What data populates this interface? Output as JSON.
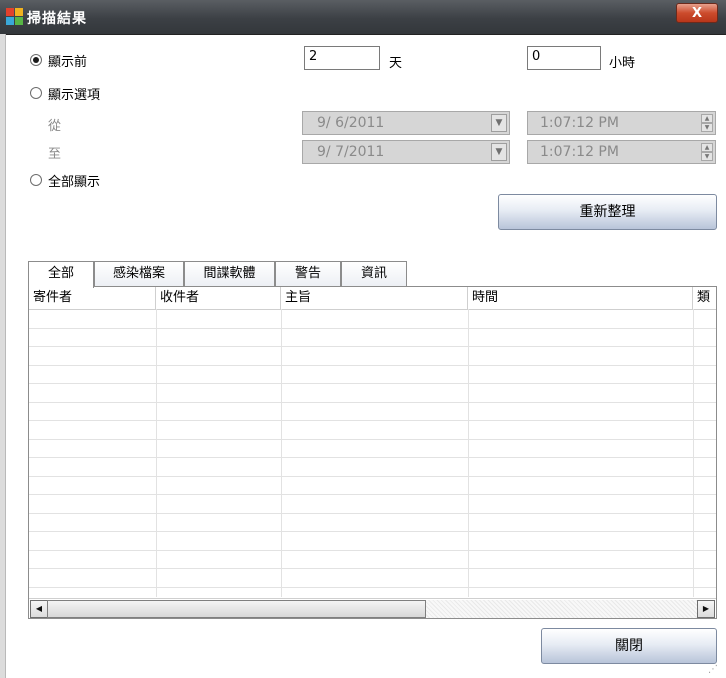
{
  "window": {
    "title": "掃描結果",
    "close_label": "X"
  },
  "options": {
    "show_last_label": "顯示前",
    "days_value": "2",
    "days_unit": "天",
    "hours_value": "0",
    "hours_unit": "小時",
    "show_range_label": "顯示選項",
    "from_label": "從",
    "to_label": "至",
    "from_date": "9/ 6/2011",
    "from_time": "1:07:12 PM",
    "to_date": "9/ 7/2011",
    "to_time": "1:07:12 PM",
    "show_all_label": "全部顯示",
    "selected": "show_last"
  },
  "refresh_label": "重新整理",
  "tabs": [
    {
      "label": "全部",
      "active": true
    },
    {
      "label": "感染檔案",
      "active": false
    },
    {
      "label": "間諜軟體",
      "active": false
    },
    {
      "label": "警告",
      "active": false
    },
    {
      "label": "資訊",
      "active": false
    }
  ],
  "table": {
    "columns": [
      "寄件者",
      "收件者",
      "主旨",
      "時間",
      "類"
    ],
    "rows": []
  },
  "close_button_label": "關閉",
  "icons": {
    "app": "avg-logo-icon",
    "close": "close-icon",
    "combo_arrow": "chevron-down-icon",
    "spin": "spin-arrows-icon",
    "scroll_left": "arrow-left-icon",
    "scroll_right": "arrow-right-icon"
  }
}
